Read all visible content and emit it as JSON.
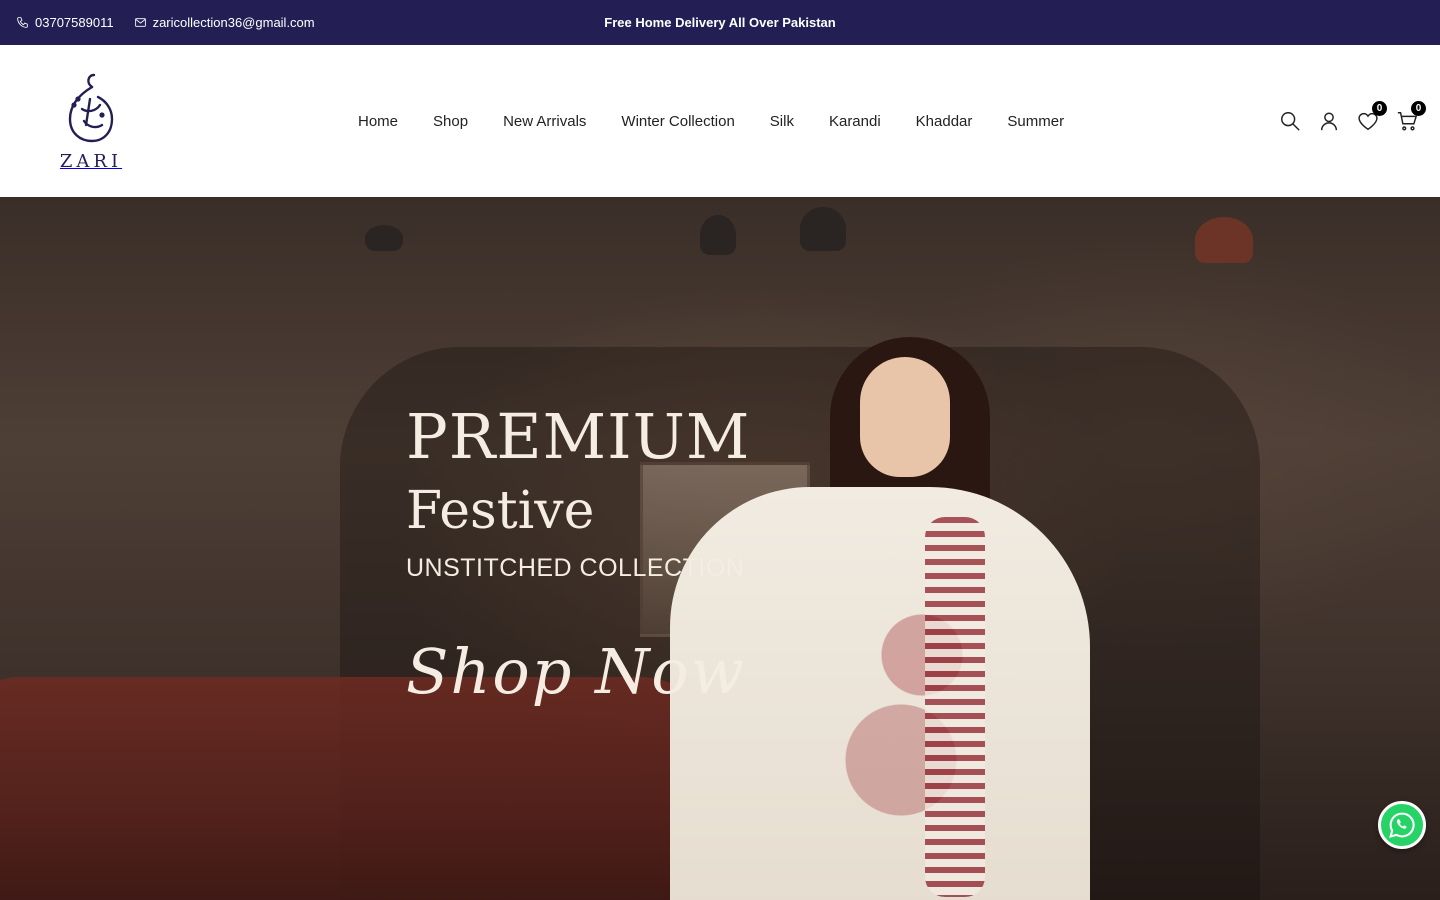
{
  "topbar": {
    "phone": "03707589011",
    "email": "zaricollection36@gmail.com",
    "promo": "Free Home Delivery All Over Pakistan"
  },
  "brand": {
    "name": "ZARI"
  },
  "nav": {
    "items": [
      {
        "label": "Home"
      },
      {
        "label": "Shop"
      },
      {
        "label": "New Arrivals"
      },
      {
        "label": "Winter Collection"
      },
      {
        "label": "Silk"
      },
      {
        "label": "Karandi"
      },
      {
        "label": "Khaddar"
      },
      {
        "label": "Summer"
      }
    ]
  },
  "header_actions": {
    "icons": [
      "search-icon",
      "account-icon",
      "wishlist-icon",
      "cart-icon"
    ],
    "wishlist_count": "0",
    "cart_count": "0"
  },
  "hero": {
    "line1": "PREMIUM",
    "line2": "Festive",
    "line3": "UNSTITCHED COLLECTION",
    "cta": "Shop Now"
  },
  "colors": {
    "topbar_bg": "#231f55",
    "brand": "#231f55",
    "whatsapp": "#25d366"
  },
  "floating": {
    "icon": "whatsapp-icon"
  }
}
